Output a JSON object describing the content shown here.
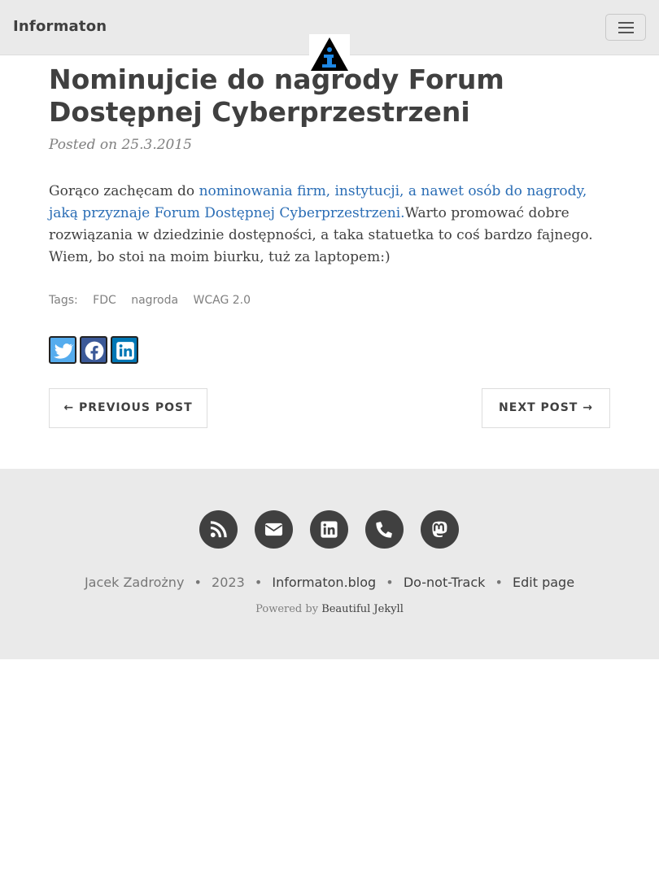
{
  "navbar": {
    "brand": "Informaton",
    "menu_toggle_icon": "hamburger-icon",
    "logo_icon": "info-triangle-logo-icon"
  },
  "post": {
    "title": "Nominujcie do nagrody Forum Dostępnej Cyberprzestrzeni",
    "meta": "Posted on 25.3.2015",
    "body_lead": "Gorąco zachęcam do ",
    "body_link": "nominowania firm, instytucji, a nawet osób do nagrody, jaką przyznaje Forum Dostępnej Cyberprzestrzeni.",
    "body_rest": "Warto promować dobre rozwiązania w dziedzinie dostępności, a taka statuetka to coś bardzo fajnego. Wiem, bo stoi na moim biurku, tuż za laptopem:)",
    "tags_label": "Tags:",
    "tags": [
      "FDC",
      "nagroda",
      "WCAG 2.0"
    ],
    "share_icons": [
      "twitter-icon",
      "facebook-icon",
      "linkedin-icon"
    ],
    "share_colors": {
      "twitter": "#55acee",
      "facebook": "#3b5998",
      "linkedin": "#0077b5"
    }
  },
  "pager": {
    "previous": "← PREVIOUS POST",
    "next": "NEXT POST →"
  },
  "footer": {
    "social_icons": [
      "rss-icon",
      "envelope-icon",
      "linkedin-icon",
      "phone-icon",
      "mastodon-icon"
    ],
    "author": "Jacek Zadrożny",
    "separator": "•",
    "year": "2023",
    "site": "Informaton.blog",
    "dnt": "Do-not-Track",
    "edit": "Edit page",
    "powered_by": "Powered by",
    "theme": "Beautiful Jekyll"
  },
  "colors": {
    "navbar_bg": "#eaeaea",
    "footer_bg": "#eaeaea",
    "text": "#404040",
    "link": "#2a6db5",
    "social_circle": "#404040"
  }
}
